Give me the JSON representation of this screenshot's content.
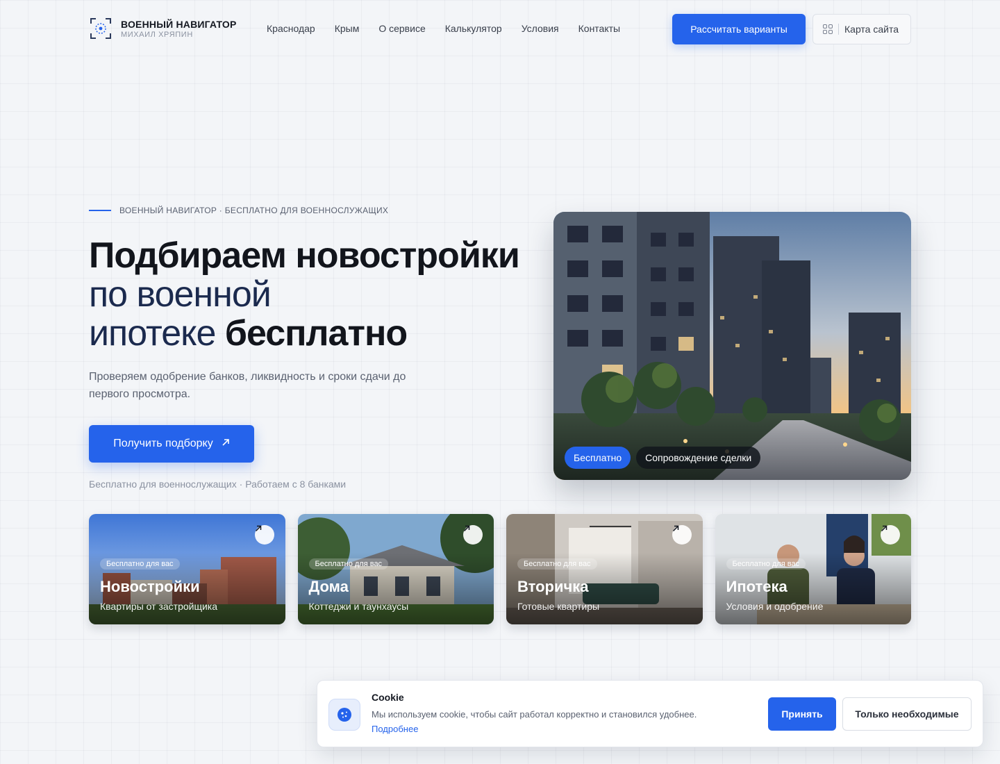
{
  "header": {
    "logo_title": "ВОЕННЫЙ НАВИГАТОР",
    "logo_sub": "МИХАИЛ ХРЯПИН",
    "nav": [
      "Краснодар",
      "Крым",
      "О сервисе",
      "Калькулятор",
      "Условия",
      "Контакты"
    ],
    "cta_label": "Рассчитать варианты",
    "sitemap_label": "Карта сайта"
  },
  "hero": {
    "eyebrow": "ВОЕННЫЙ НАВИГАТОР · БЕСПЛАТНО ДЛЯ ВОЕННОСЛУЖАЩИХ",
    "headline_1": "Подбираем новостройки",
    "headline_2": "по военной",
    "headline_3a": "ипотеке",
    "headline_3b": "бесплатно",
    "lead": "Проверяем одобрение банков, ликвидность и сроки сдачи до первого просмотра.",
    "cta_label": "Получить подборку",
    "note": "Бесплатно для военнослужащих · Работаем с 8 банками",
    "chip_free": "Бесплатно",
    "chip_support": "Сопровождение сделки"
  },
  "cards": [
    {
      "badge": "Бесплатно для вас",
      "title": "Новостройки",
      "subtitle": "Квартиры от застройщика"
    },
    {
      "badge": "Бесплатно для вас",
      "title": "Дома",
      "subtitle": "Коттеджи и таунхаусы"
    },
    {
      "badge": "Бесплатно для вас",
      "title": "Вторичка",
      "subtitle": "Готовые квартиры"
    },
    {
      "badge": "Бесплатно для вас",
      "title": "Ипотека",
      "subtitle": "Условия и одобрение"
    }
  ],
  "cookie": {
    "title": "Cookie",
    "text": "Мы используем cookie, чтобы сайт работал корректно и становился удобнее.",
    "link": "Подробнее",
    "accept_label": "Принять",
    "necessary_label": "Только необходимые"
  },
  "colors": {
    "accent": "#2563eb",
    "headline_navy": "#1b2a4e",
    "background": "#f3f5f8"
  },
  "icons": [
    "logo-icon",
    "grid-icon",
    "arrow-up-right-icon",
    "cookie-icon"
  ]
}
